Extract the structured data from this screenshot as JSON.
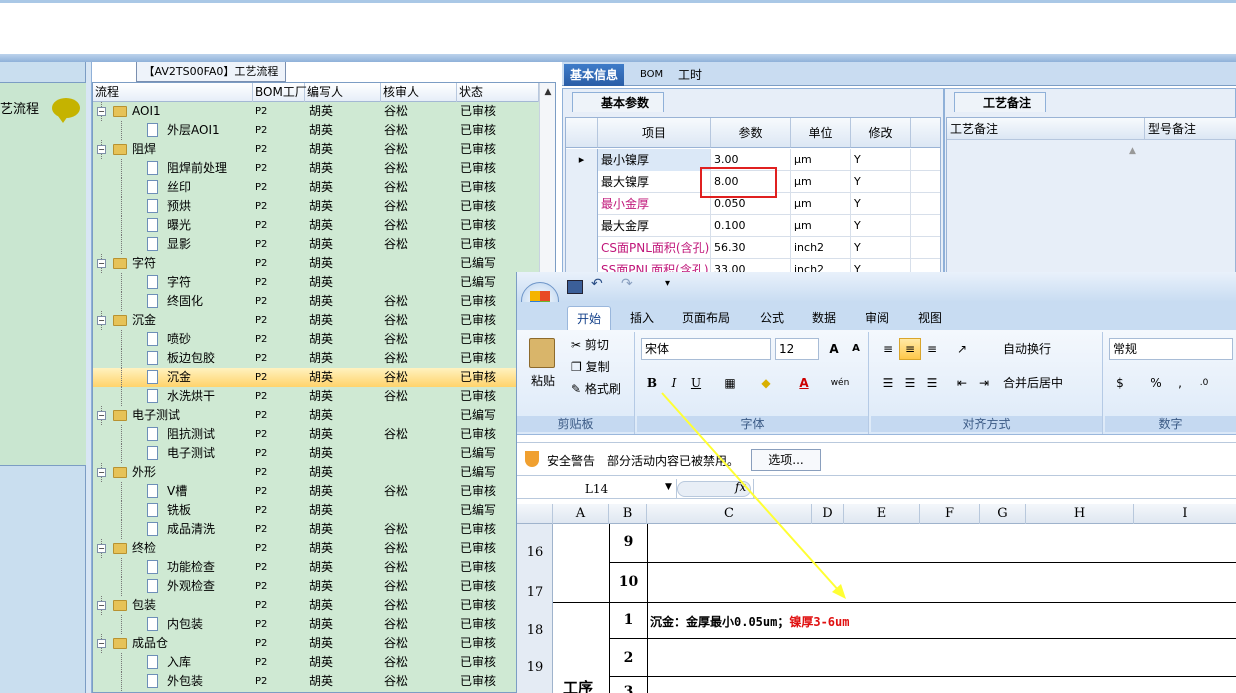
{
  "left_panel": {
    "label": "艺流程"
  },
  "tree": {
    "title": "【AV2TS00FA0】工艺流程",
    "columns": [
      "流程",
      "BOM工厂",
      "编写人",
      "核审人",
      "状态"
    ],
    "rows": [
      {
        "kind": "folder",
        "name": "AOI1",
        "bom": "P2",
        "writer": "胡英",
        "reviewer": "谷松",
        "status": "已审核"
      },
      {
        "kind": "doc",
        "name": "外层AOI1",
        "bom": "P2",
        "writer": "胡英",
        "reviewer": "谷松",
        "status": "已审核"
      },
      {
        "kind": "folder",
        "name": "阻焊",
        "bom": "P2",
        "writer": "胡英",
        "reviewer": "谷松",
        "status": "已审核"
      },
      {
        "kind": "doc",
        "name": "阻焊前处理",
        "bom": "P2",
        "writer": "胡英",
        "reviewer": "谷松",
        "status": "已审核"
      },
      {
        "kind": "doc",
        "name": "丝印",
        "bom": "P2",
        "writer": "胡英",
        "reviewer": "谷松",
        "status": "已审核"
      },
      {
        "kind": "doc",
        "name": "预烘",
        "bom": "P2",
        "writer": "胡英",
        "reviewer": "谷松",
        "status": "已审核"
      },
      {
        "kind": "doc",
        "name": "曝光",
        "bom": "P2",
        "writer": "胡英",
        "reviewer": "谷松",
        "status": "已审核"
      },
      {
        "kind": "doc",
        "name": "显影",
        "bom": "P2",
        "writer": "胡英",
        "reviewer": "谷松",
        "status": "已审核"
      },
      {
        "kind": "folder",
        "name": "字符",
        "bom": "P2",
        "writer": "胡英",
        "reviewer": "",
        "status": "已编写"
      },
      {
        "kind": "doc",
        "name": "字符",
        "bom": "P2",
        "writer": "胡英",
        "reviewer": "",
        "status": "已编写"
      },
      {
        "kind": "doc",
        "name": "终固化",
        "bom": "P2",
        "writer": "胡英",
        "reviewer": "谷松",
        "status": "已审核"
      },
      {
        "kind": "folder",
        "name": "沉金",
        "bom": "P2",
        "writer": "胡英",
        "reviewer": "谷松",
        "status": "已审核"
      },
      {
        "kind": "doc",
        "name": "喷砂",
        "bom": "P2",
        "writer": "胡英",
        "reviewer": "谷松",
        "status": "已审核"
      },
      {
        "kind": "doc",
        "name": "板边包胶",
        "bom": "P2",
        "writer": "胡英",
        "reviewer": "谷松",
        "status": "已审核"
      },
      {
        "kind": "doc",
        "name": "沉金",
        "bom": "P2",
        "writer": "胡英",
        "reviewer": "谷松",
        "status": "已审核",
        "selected": true
      },
      {
        "kind": "doc",
        "name": "水洗烘干",
        "bom": "P2",
        "writer": "胡英",
        "reviewer": "谷松",
        "status": "已审核"
      },
      {
        "kind": "folder",
        "name": "电子测试",
        "bom": "P2",
        "writer": "胡英",
        "reviewer": "",
        "status": "已编写"
      },
      {
        "kind": "doc",
        "name": "阻抗测试",
        "bom": "P2",
        "writer": "胡英",
        "reviewer": "谷松",
        "status": "已审核"
      },
      {
        "kind": "doc",
        "name": "电子测试",
        "bom": "P2",
        "writer": "胡英",
        "reviewer": "",
        "status": "已编写"
      },
      {
        "kind": "folder",
        "name": "外形",
        "bom": "P2",
        "writer": "胡英",
        "reviewer": "",
        "status": "已编写"
      },
      {
        "kind": "doc",
        "name": "V槽",
        "bom": "P2",
        "writer": "胡英",
        "reviewer": "谷松",
        "status": "已审核"
      },
      {
        "kind": "doc",
        "name": "铣板",
        "bom": "P2",
        "writer": "胡英",
        "reviewer": "",
        "status": "已编写"
      },
      {
        "kind": "doc",
        "name": "成品清洗",
        "bom": "P2",
        "writer": "胡英",
        "reviewer": "谷松",
        "status": "已审核"
      },
      {
        "kind": "folder",
        "name": "终检",
        "bom": "P2",
        "writer": "胡英",
        "reviewer": "谷松",
        "status": "已审核"
      },
      {
        "kind": "doc",
        "name": "功能检查",
        "bom": "P2",
        "writer": "胡英",
        "reviewer": "谷松",
        "status": "已审核"
      },
      {
        "kind": "doc",
        "name": "外观检查",
        "bom": "P2",
        "writer": "胡英",
        "reviewer": "谷松",
        "status": "已审核"
      },
      {
        "kind": "folder",
        "name": "包装",
        "bom": "P2",
        "writer": "胡英",
        "reviewer": "谷松",
        "status": "已审核"
      },
      {
        "kind": "doc",
        "name": "内包装",
        "bom": "P2",
        "writer": "胡英",
        "reviewer": "谷松",
        "status": "已审核"
      },
      {
        "kind": "folder",
        "name": "成品仓",
        "bom": "P2",
        "writer": "胡英",
        "reviewer": "谷松",
        "status": "已审核"
      },
      {
        "kind": "doc",
        "name": "入库",
        "bom": "P2",
        "writer": "胡英",
        "reviewer": "谷松",
        "status": "已审核"
      },
      {
        "kind": "doc",
        "name": "外包装",
        "bom": "P2",
        "writer": "胡英",
        "reviewer": "谷松",
        "status": "已审核"
      }
    ]
  },
  "right_tabs": [
    "基本信息",
    "BOM",
    "工时"
  ],
  "basic_params": {
    "tab": "基本参数",
    "columns": [
      "项目",
      "参数",
      "单位",
      "修改"
    ],
    "rows": [
      {
        "item": "最小镍厚",
        "param": "3.00",
        "unit": "μm",
        "mod": "Y",
        "pink": false
      },
      {
        "item": "最大镍厚",
        "param": "8.00",
        "unit": "μm",
        "mod": "Y",
        "pink": false
      },
      {
        "item": "最小金厚",
        "param": "0.050",
        "unit": "μm",
        "mod": "Y",
        "pink": true
      },
      {
        "item": "最大金厚",
        "param": "0.100",
        "unit": "μm",
        "mod": "Y",
        "pink": false
      },
      {
        "item": "CS面PNL面积(含孔)",
        "param": "56.30",
        "unit": "inch2",
        "mod": "Y",
        "pink": true
      },
      {
        "item": "SS面PNL面积(含孔)",
        "param": "33.00",
        "unit": "inch2",
        "mod": "Y",
        "pink": true
      }
    ]
  },
  "notes": {
    "tab": "工艺备注",
    "col1": "工艺备注",
    "col2": "型号备注"
  },
  "excel": {
    "ribbon_tabs": [
      "开始",
      "插入",
      "页面布局",
      "公式",
      "数据",
      "审阅",
      "视图"
    ],
    "clipboard": {
      "paste": "粘贴",
      "cut": "剪切",
      "copy": "复制",
      "format": "格式刷",
      "label": "剪贴板"
    },
    "font": {
      "name": "宋体",
      "size": "12",
      "label": "字体"
    },
    "align": {
      "wrap": "自动换行",
      "merge": "合并后居中",
      "label": "对齐方式"
    },
    "number": {
      "format": "常规",
      "label": "数字"
    },
    "security": {
      "title": "安全警告",
      "text": "部分活动内容已被禁用。",
      "button": "选项..."
    },
    "cell_ref": "L14",
    "fx": "fx",
    "columns": [
      "A",
      "B",
      "C",
      "D",
      "E",
      "F",
      "G",
      "H",
      "I"
    ],
    "rows": [
      {
        "num": "16",
        "b": "9",
        "c": ""
      },
      {
        "num": "17",
        "b": "10",
        "c": ""
      },
      {
        "num": "18",
        "b": "1",
        "c_black": "沉金：金厚最小0.05um；",
        "c_red": "镍厚3-6um"
      },
      {
        "num": "19",
        "b": "2",
        "c": ""
      }
    ],
    "a_text": "工序",
    "b_partial": "3"
  },
  "colors": {
    "tree_bg": "#cfe9d3",
    "selected_row": "#ffd36b",
    "red_box": "#e02020",
    "arrow": "#ffff33",
    "pink_text": "#c0177a"
  }
}
